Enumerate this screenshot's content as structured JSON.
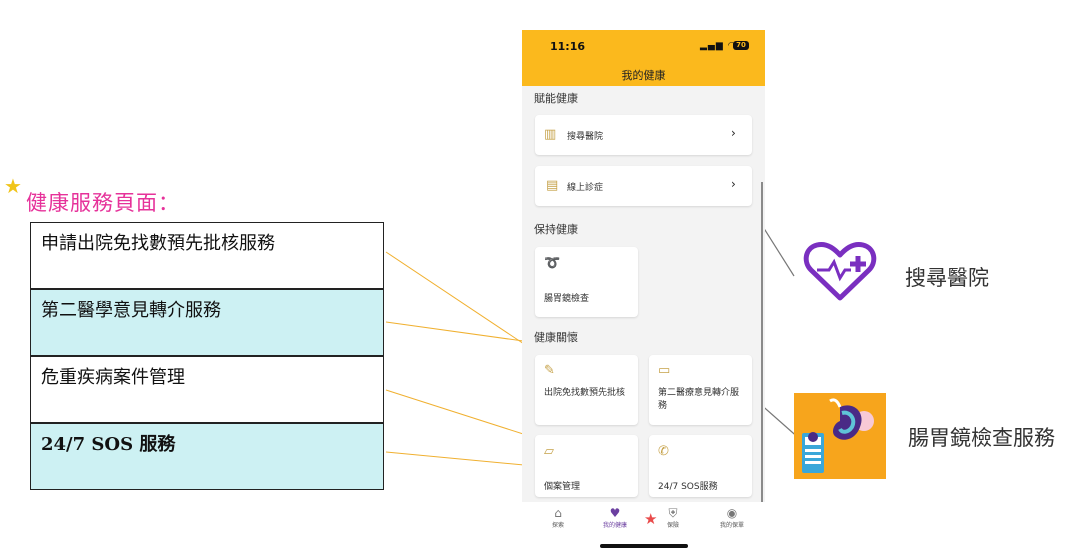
{
  "annotation": {
    "title": "健康服務頁面：",
    "services": [
      "申請出院免找數預先批核服務",
      "第二醫學意見轉介服務",
      "危重疾病案件管理",
      "24/7 SOS 服務"
    ],
    "right_labels": {
      "search_hospital": "搜尋醫院",
      "endoscopy_service": "腸胃鏡檢查服務"
    }
  },
  "phone": {
    "status": {
      "time": "11:16",
      "signal": "▂▄▆ ◠",
      "battery": "70"
    },
    "app_title": "我的健康",
    "sections": {
      "empower": {
        "label": "賦能健康",
        "items": [
          {
            "label": "搜尋醫院",
            "icon": "hospital-icon"
          },
          {
            "label": "線上診症",
            "icon": "online-consult-icon"
          }
        ]
      },
      "maintain": {
        "label": "保持健康",
        "items": [
          {
            "label": "腸胃鏡檢查",
            "icon": "endoscopy-icon"
          }
        ]
      },
      "care": {
        "label": "健康關懷",
        "items": [
          {
            "label": "出院免找數預先批核",
            "icon": "form-edit-icon"
          },
          {
            "label": "第二醫療意見轉介服務",
            "icon": "chat-icon"
          },
          {
            "label": "個案管理",
            "icon": "folder-icon"
          },
          {
            "label": "24/7 SOS服務",
            "icon": "phone-call-icon"
          }
        ]
      }
    },
    "tabs": [
      {
        "label": "探索",
        "icon": "home-icon"
      },
      {
        "label": "我的健康",
        "icon": "heart-icon"
      },
      {
        "label": "保險",
        "icon": "shield-icon"
      },
      {
        "label": "我的保單",
        "icon": "user-icon"
      }
    ]
  },
  "colors": {
    "brand_yellow": "#fbb91d",
    "accent_purple": "#7a2fc0",
    "highlight_pink": "#e6329a",
    "table_cyan": "#cdf1f3",
    "connector_orange": "#f0b030"
  }
}
